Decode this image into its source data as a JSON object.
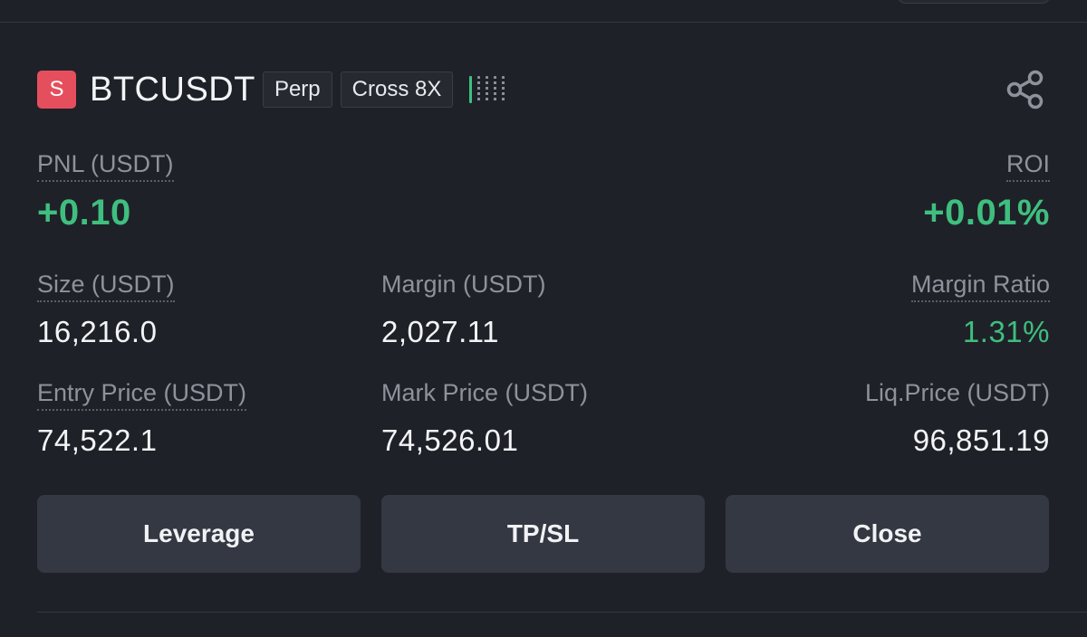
{
  "position": {
    "side_badge": "S",
    "symbol": "BTCUSDT",
    "tags": [
      "Perp",
      "Cross 8X"
    ],
    "risk_level": {
      "filled": 1,
      "total": 5
    },
    "share_icon": "share-icon"
  },
  "stats": {
    "pnl_label": "PNL (USDT)",
    "pnl_value": "+0.10",
    "roi_label": "ROI",
    "roi_value": "+0.01%",
    "size_label": "Size (USDT)",
    "size_value": "16,216.0",
    "margin_label": "Margin (USDT)",
    "margin_value": "2,027.11",
    "margin_ratio_label": "Margin Ratio",
    "margin_ratio_value": "1.31%",
    "entry_price_label": "Entry Price (USDT)",
    "entry_price_value": "74,522.1",
    "mark_price_label": "Mark Price (USDT)",
    "mark_price_value": "74,526.01",
    "liq_price_label": "Liq.Price (USDT)",
    "liq_price_value": "96,851.19"
  },
  "actions": {
    "leverage": "Leverage",
    "tpsl": "TP/SL",
    "close": "Close"
  },
  "colors": {
    "positive": "#3fbf7f",
    "short": "#e54f5d",
    "background": "#1f2128",
    "button": "#343843"
  }
}
